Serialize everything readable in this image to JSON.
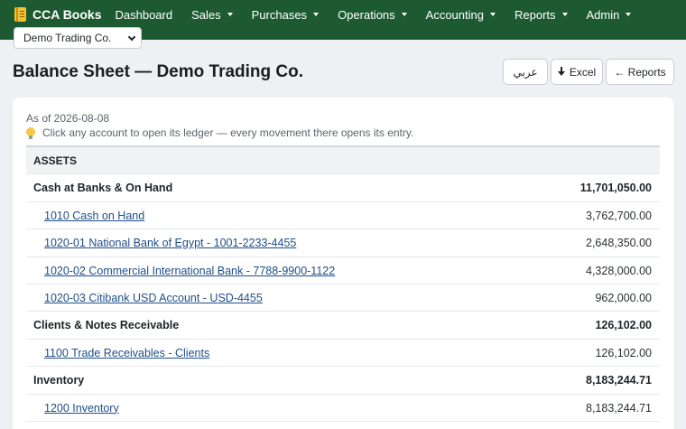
{
  "brand": {
    "name": "CCA Books",
    "icon": "ledger-book-icon"
  },
  "nav": [
    {
      "label": "Dashboard",
      "dropdown": false
    },
    {
      "label": "Sales",
      "dropdown": true
    },
    {
      "label": "Purchases",
      "dropdown": true
    },
    {
      "label": "Operations",
      "dropdown": true
    },
    {
      "label": "Accounting",
      "dropdown": true
    },
    {
      "label": "Reports",
      "dropdown": true
    },
    {
      "label": "Admin",
      "dropdown": true
    }
  ],
  "company_selector": {
    "value": "Demo Trading Co."
  },
  "page": {
    "title": "Balance Sheet — Demo Trading Co."
  },
  "actions": {
    "arabic": "عربي",
    "excel": "Excel",
    "reports": "← Reports"
  },
  "report": {
    "as_of": "As of 2026-08-08",
    "hint": "Click any account to open its ledger — every movement there opens its entry.",
    "rows": [
      {
        "type": "section",
        "label": "ASSETS",
        "amount": ""
      },
      {
        "type": "group",
        "label": "Cash at Banks & On Hand",
        "amount": "11,701,050.00"
      },
      {
        "type": "account",
        "label": "1010 Cash on Hand",
        "amount": "3,762,700.00"
      },
      {
        "type": "account",
        "label": "1020-01 National Bank of Egypt - 1001-2233-4455",
        "amount": "2,648,350.00"
      },
      {
        "type": "account",
        "label": "1020-02 Commercial International Bank - 7788-9900-1122",
        "amount": "4,328,000.00"
      },
      {
        "type": "account",
        "label": "1020-03 Citibank USD Account - USD-4455",
        "amount": "962,000.00"
      },
      {
        "type": "group",
        "label": "Clients & Notes Receivable",
        "amount": "126,102.00"
      },
      {
        "type": "account",
        "label": "1100 Trade Receivables - Clients",
        "amount": "126,102.00"
      },
      {
        "type": "group",
        "label": "Inventory",
        "amount": "8,183,244.71"
      },
      {
        "type": "account",
        "label": "1200 Inventory",
        "amount": "8,183,244.71"
      }
    ]
  },
  "colors": {
    "navbar": "#1d5a32",
    "link": "#1f4e8a",
    "background": "#eef0f3"
  }
}
